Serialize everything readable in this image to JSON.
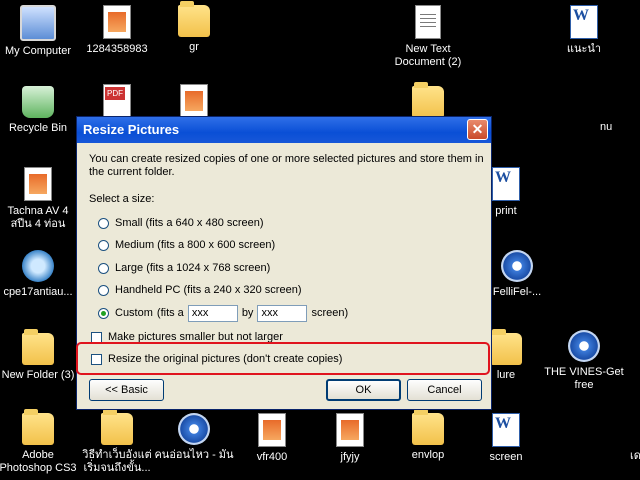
{
  "desktop_icons": [
    {
      "label": "My Computer",
      "icon": "computer-icon"
    },
    {
      "label": "1284358983",
      "icon": "image-file-icon"
    },
    {
      "label": "gr",
      "icon": "folder-icon"
    },
    {
      "label": "New Text Document (2)",
      "icon": "text-document-icon"
    },
    {
      "label": "แนะนำ",
      "icon": "word-document-icon"
    },
    {
      "label": "Recycle Bin",
      "icon": "recycle-bin-icon"
    },
    {
      "label": "Tachna AV 4 สปีน 4 ท่อน",
      "icon": "image-file-icon"
    },
    {
      "label": "print",
      "icon": "word-document-icon"
    },
    {
      "label": "cpe17antiau...",
      "icon": "tool-icon"
    },
    {
      "label": "FelliFel-...",
      "icon": "media-file-icon"
    },
    {
      "label": "New Folder (3)",
      "icon": "folder-icon"
    },
    {
      "label": "lure",
      "icon": "folder-icon"
    },
    {
      "label": "THE VINES-Get free",
      "icon": "media-file-icon"
    },
    {
      "label": "Adobe Photoshop CS3",
      "icon": "folder-icon"
    },
    {
      "label": "วิธีทำเว็บอังแต่ เริ่มจนถึงขั้น...",
      "icon": "folder-icon"
    },
    {
      "label": "คนอ่อนไหว - มัน",
      "icon": "media-file-icon"
    },
    {
      "label": "vfr400",
      "icon": "image-file-icon"
    },
    {
      "label": "jfyjy",
      "icon": "image-file-icon"
    },
    {
      "label": "envlop",
      "icon": "folder-icon"
    },
    {
      "label": "screen",
      "icon": "word-document-icon"
    },
    {
      "label": "nu",
      "icon": ""
    },
    {
      "label": "เด",
      "icon": ""
    }
  ],
  "dialog": {
    "title": "Resize Pictures",
    "intro": "You can create resized copies of one or more selected pictures and store them in the current folder.",
    "select_label": "Select a size:",
    "options": [
      {
        "label": "Small (fits a 640 x 480 screen)",
        "selected": false
      },
      {
        "label": "Medium (fits a 800 x 600 screen)",
        "selected": false
      },
      {
        "label": "Large (fits a 1024 x 768 screen)",
        "selected": false
      },
      {
        "label": "Handheld PC (fits a 240 x 320 screen)",
        "selected": false
      },
      {
        "label": "Custom",
        "selected": true
      }
    ],
    "custom": {
      "prefix": "(fits a",
      "width_value": "xxx",
      "by": "by",
      "height_value": "xxx",
      "suffix": "screen)"
    },
    "checkboxes": [
      {
        "label": "Make pictures smaller but not larger",
        "checked": false
      },
      {
        "label": "Resize the original pictures (don't create copies)",
        "checked": false
      }
    ],
    "buttons": {
      "basic": "<< Basic",
      "ok": "OK",
      "cancel": "Cancel"
    },
    "close_glyph": "✕"
  },
  "colors": {
    "titlebar": "#0a4fd6",
    "dialog_bg": "#ece9d8",
    "highlight": "#e0141e",
    "desktop_bg": "#000000"
  }
}
